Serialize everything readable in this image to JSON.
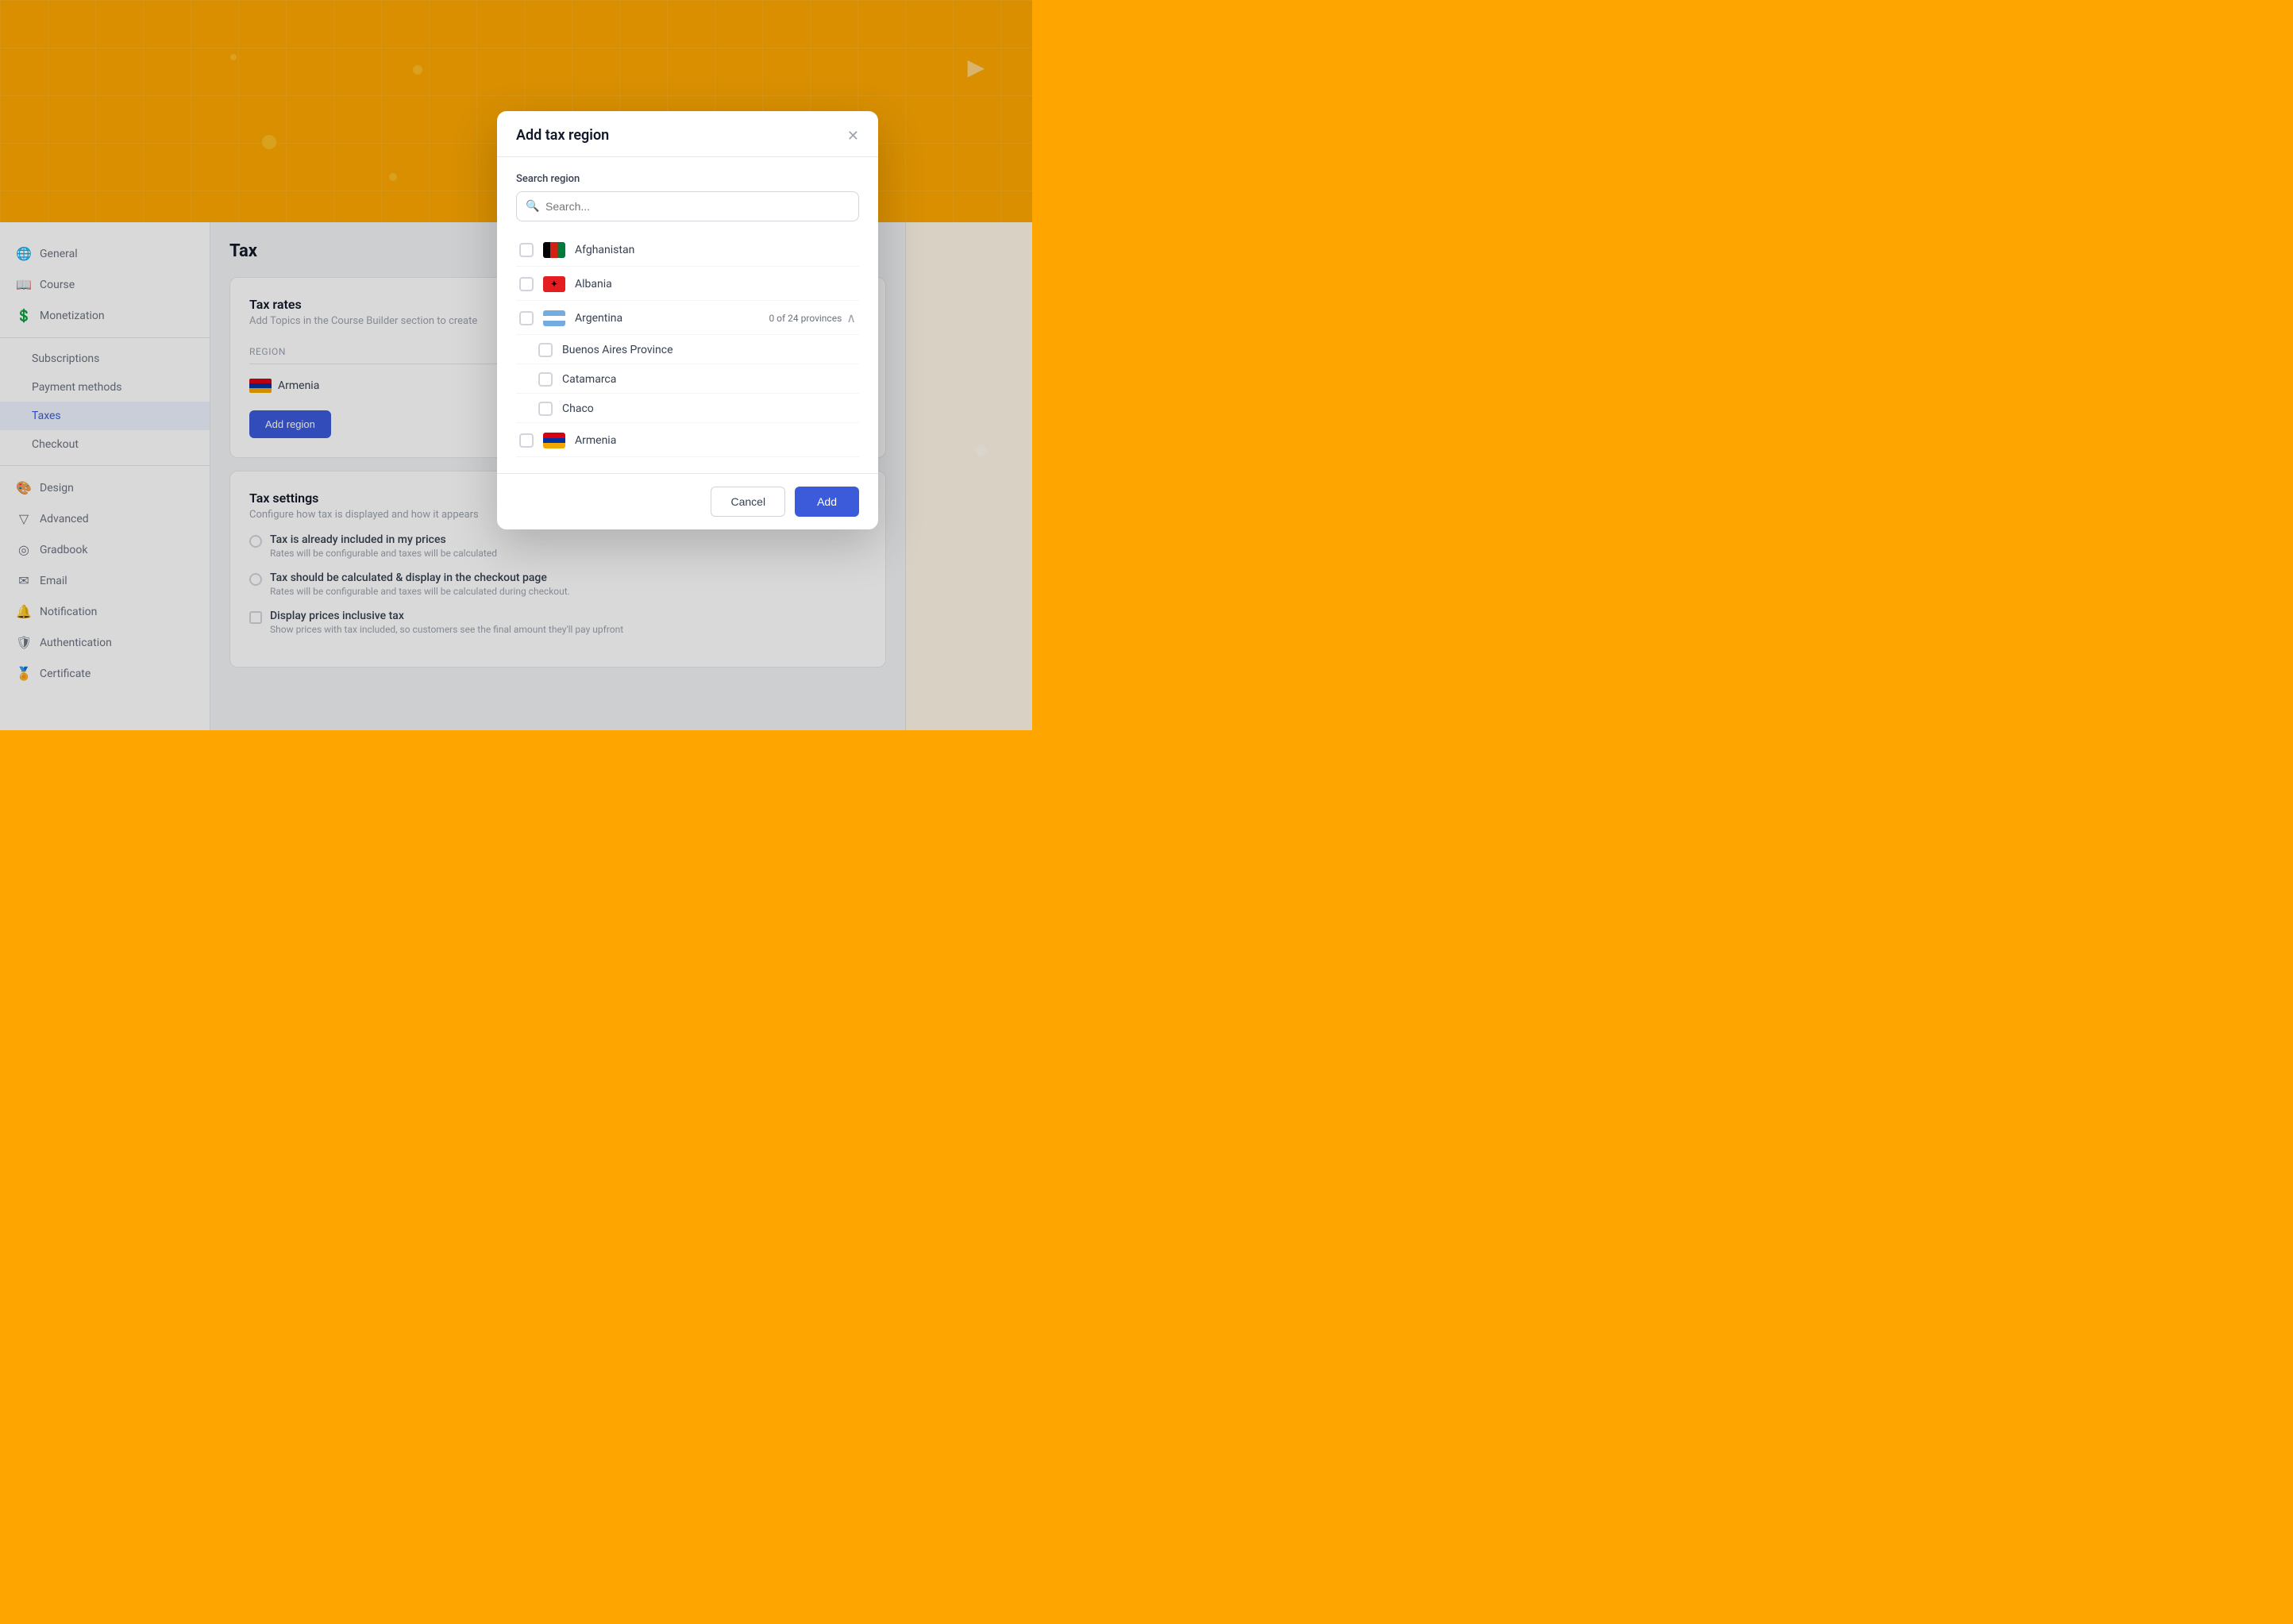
{
  "background": {
    "color": "#FFA800"
  },
  "sidebar": {
    "items": [
      {
        "id": "general",
        "label": "General",
        "icon": "🌐",
        "active": false
      },
      {
        "id": "course",
        "label": "Course",
        "icon": "📖",
        "active": false
      },
      {
        "id": "monetization",
        "label": "Monetization",
        "icon": "💲",
        "active": false
      },
      {
        "id": "subscriptions",
        "label": "Subscriptions",
        "icon": "",
        "active": false,
        "indent": true
      },
      {
        "id": "payment-methods",
        "label": "Payment methods",
        "icon": "",
        "active": false,
        "indent": true
      },
      {
        "id": "taxes",
        "label": "Taxes",
        "icon": "",
        "active": true,
        "indent": true
      },
      {
        "id": "checkout",
        "label": "Checkout",
        "icon": "",
        "active": false,
        "indent": true
      },
      {
        "id": "design",
        "label": "Design",
        "icon": "🎨",
        "active": false
      },
      {
        "id": "advanced",
        "label": "Advanced",
        "icon": "🔧",
        "active": false
      },
      {
        "id": "gradbook",
        "label": "Gradbook",
        "icon": "📊",
        "active": false
      },
      {
        "id": "email",
        "label": "Email",
        "icon": "✉️",
        "active": false
      },
      {
        "id": "notification",
        "label": "Notification",
        "icon": "🔔",
        "active": false
      },
      {
        "id": "authentication",
        "label": "Authentication",
        "icon": "🛡️",
        "active": false
      },
      {
        "id": "certificate",
        "label": "Certificate",
        "icon": "🏅",
        "active": false
      }
    ]
  },
  "page": {
    "title": "Tax",
    "tax_rates": {
      "title": "Tax rates",
      "subtitle": "Add Topics in the Course Builder section to create",
      "table_header": "Region",
      "region_row": "Armenia",
      "add_button": "Add region"
    },
    "tax_settings": {
      "title": "Tax settings",
      "subtitle": "Configure how tax is displayed and how it appears",
      "option1_label": "Tax is already included in my prices",
      "option1_desc": "Rates will be configurable and taxes will be calculated",
      "option2_label": "Tax should be calculated & display in the checkout page",
      "option2_desc": "Rates will be configurable and taxes will be calculated during checkout.",
      "option3_label": "Display prices inclusive tax",
      "option3_desc": "Show prices with tax included, so customers see the final amount they'll pay upfront"
    }
  },
  "modal": {
    "title": "Add tax region",
    "search_label": "Search region",
    "search_placeholder": "Search...",
    "countries": [
      {
        "id": "af",
        "name": "Afghanistan",
        "flag_type": "af",
        "has_provinces": false,
        "checked": false
      },
      {
        "id": "al",
        "name": "Albania",
        "flag_type": "al",
        "has_provinces": false,
        "checked": false
      },
      {
        "id": "ar",
        "name": "Argentina",
        "flag_type": "ar",
        "has_provinces": true,
        "province_count": 24,
        "province_selected": 0,
        "expanded": true,
        "checked": false
      },
      {
        "id": "am2",
        "name": "Armenia",
        "flag_type": "am",
        "has_provinces": false,
        "checked": false
      }
    ],
    "provinces": [
      {
        "name": "Buenos Aires Province",
        "checked": false
      },
      {
        "name": "Catamarca",
        "checked": false
      },
      {
        "name": "Chaco",
        "checked": false
      }
    ],
    "footer": {
      "cancel_label": "Cancel",
      "add_label": "Add"
    }
  }
}
